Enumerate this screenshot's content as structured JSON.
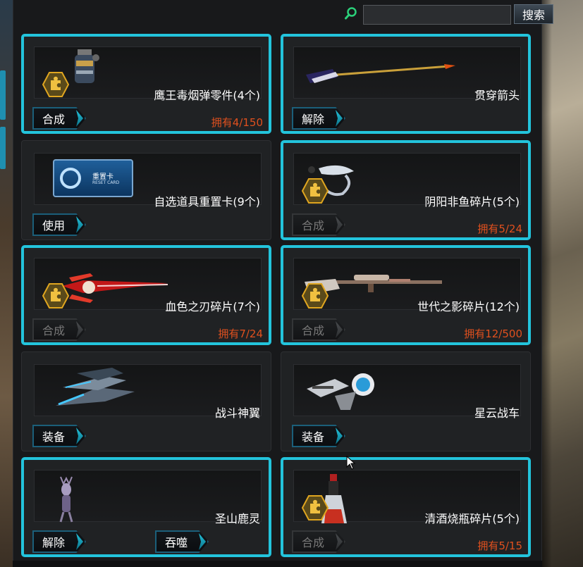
{
  "search": {
    "placeholder": "",
    "value": "",
    "button_label": "搜索"
  },
  "colors": {
    "highlight": "#23c4dc",
    "owned_text": "#e0501e",
    "badge": "#e0a620"
  },
  "items": [
    {
      "name": "鹰王毒烟弹零件(4个)",
      "owned": "拥有4/150",
      "button": "合成",
      "button_enabled": true,
      "highlighted": true,
      "badge": true,
      "icon": "grenade-icon"
    },
    {
      "name": "贯穿箭头",
      "owned": "",
      "button": "解除",
      "button_enabled": true,
      "highlighted": true,
      "badge": false,
      "icon": "arrow-icon"
    },
    {
      "name": "自选道具重置卡(9个)",
      "owned": "",
      "button": "使用",
      "button_enabled": true,
      "highlighted": false,
      "badge": false,
      "icon": "reset-card-icon",
      "card_text": "重置卡",
      "card_subtext": "RESET CARD"
    },
    {
      "name": "阴阳非鱼碎片(5个)",
      "owned": "拥有5/24",
      "button": "合成",
      "button_enabled": false,
      "highlighted": true,
      "badge": true,
      "icon": "fish-icon"
    },
    {
      "name": "血色之刃碎片(7个)",
      "owned": "拥有7/24",
      "button": "合成",
      "button_enabled": false,
      "highlighted": true,
      "badge": true,
      "icon": "blade-icon"
    },
    {
      "name": "世代之影碎片(12个)",
      "owned": "拥有12/500",
      "button": "合成",
      "button_enabled": false,
      "highlighted": true,
      "badge": true,
      "icon": "sniper-rifle-icon"
    },
    {
      "name": "战斗神翼",
      "owned": "",
      "button": "装备",
      "button_enabled": true,
      "highlighted": false,
      "badge": false,
      "icon": "wings-icon"
    },
    {
      "name": "星云战车",
      "owned": "",
      "button": "装备",
      "button_enabled": true,
      "highlighted": false,
      "badge": false,
      "icon": "vehicle-icon"
    },
    {
      "name": "圣山鹿灵",
      "owned": "",
      "button": "解除",
      "button2": "吞噬",
      "button_enabled": true,
      "highlighted": true,
      "badge": false,
      "icon": "deer-spirit-icon"
    },
    {
      "name": "清酒烧瓶碎片(5个)",
      "owned": "拥有5/15",
      "button": "合成",
      "button_enabled": false,
      "highlighted": true,
      "badge": true,
      "icon": "bottle-icon"
    }
  ]
}
